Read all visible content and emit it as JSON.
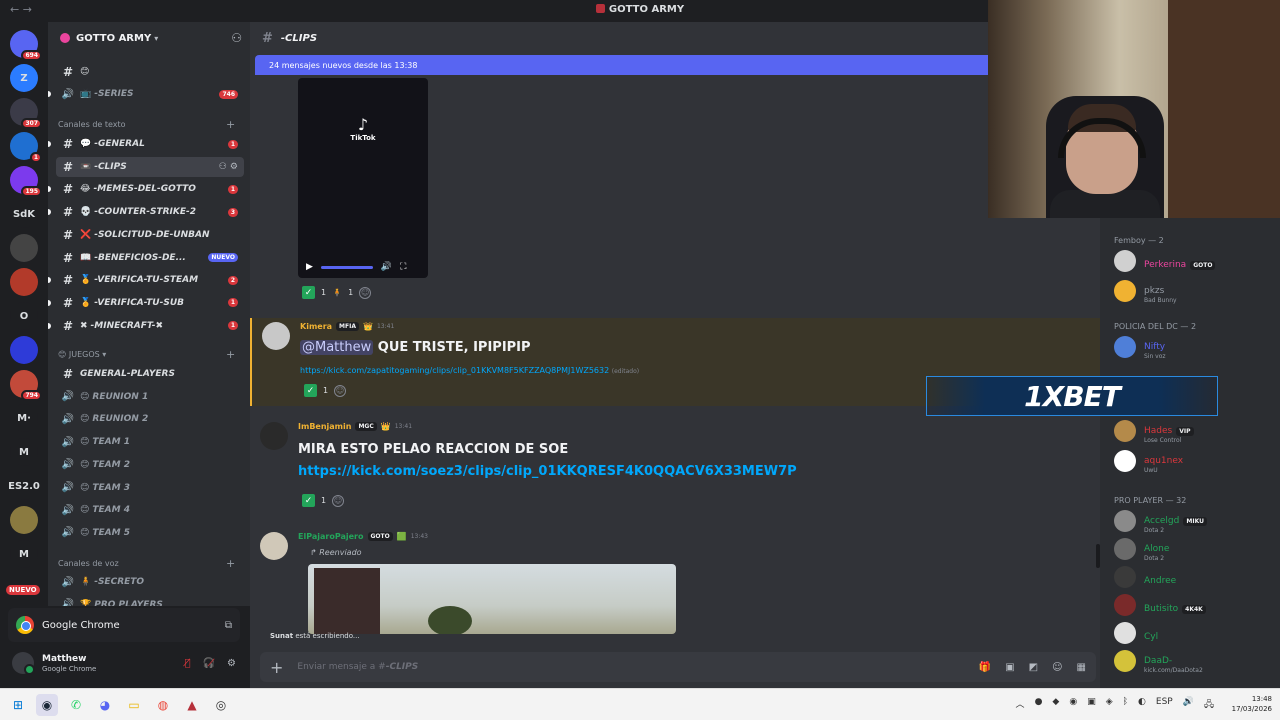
{
  "window": {
    "title": "GOTTO ARMY",
    "nav": "←  →"
  },
  "rail": {
    "servers": [
      {
        "icon": "discord-logo-icon",
        "label": "",
        "badge": "694",
        "color": "#5865f2"
      },
      {
        "icon": "server-z-icon",
        "label": "Z",
        "badge": "",
        "color": "#2b7cff"
      },
      {
        "icon": "server-icon",
        "label": "",
        "badge": "307",
        "color": "#3b3b48"
      },
      {
        "icon": "server-icon",
        "label": "",
        "badge": "1",
        "color": "#1f6fd1"
      },
      {
        "icon": "server-icon",
        "label": "",
        "badge": "195",
        "color": "#7c3aed"
      },
      {
        "icon": "server-sdk-icon",
        "label": "SdK",
        "badge": "",
        "color": "#1e1f22"
      },
      {
        "icon": "server-icon",
        "label": "",
        "badge": "",
        "color": "#444"
      },
      {
        "icon": "server-icon",
        "label": "",
        "badge": "",
        "color": "#b23a2a"
      },
      {
        "icon": "server-icon",
        "label": "O",
        "badge": "",
        "color": "#1e1f22"
      },
      {
        "icon": "server-icon",
        "label": "",
        "badge": "",
        "color": "#2e3bd8"
      },
      {
        "icon": "server-icon",
        "label": "",
        "badge": "794",
        "color": "#c24a3a"
      },
      {
        "icon": "server-m-icon",
        "label": "M·",
        "badge": "",
        "color": "#1e1f22"
      },
      {
        "icon": "server-m-icon",
        "label": "M",
        "badge": "",
        "color": "#1e1f22"
      },
      {
        "icon": "server-es-icon",
        "label": "ES2.0",
        "badge": "",
        "color": "#1e1f22"
      },
      {
        "icon": "server-icon",
        "label": "",
        "badge": "",
        "color": "#8a7a40"
      },
      {
        "icon": "server-m-icon",
        "label": "M",
        "badge": "",
        "color": "#1e1f22"
      }
    ],
    "new_label": "NUEVO"
  },
  "sidebar": {
    "server_name": "GOTTO ARMY",
    "top_channels": [
      {
        "name": "",
        "emoji": "😊",
        "type": "text",
        "badge": ""
      },
      {
        "name": "-SERIES",
        "emoji": "📺",
        "type": "voice",
        "badge": "746"
      }
    ],
    "text_category": "Canales de texto",
    "text_channels": [
      {
        "name": "-GENERAL",
        "emoji": "💬",
        "badge": "1",
        "active": false
      },
      {
        "name": "-CLIPS",
        "emoji": "📼",
        "badge": "",
        "active": true
      },
      {
        "name": "-MEMES-DEL-GOTTO",
        "emoji": "😂",
        "badge": "1",
        "active": false
      },
      {
        "name": "-COUNTER-STRIKE-2",
        "emoji": "💀",
        "badge": "3",
        "active": false
      },
      {
        "name": "-SOLICITUD-DE-UNBAN",
        "emoji": "❌",
        "badge": "",
        "active": false
      },
      {
        "name": "-BENEFICIOS-DE...",
        "emoji": "📖",
        "badge": "NUEVO",
        "active": false
      },
      {
        "name": "-VERIFICA-TU-STEAM",
        "emoji": "🏅",
        "badge": "2",
        "active": false
      },
      {
        "name": "-VERIFICA-TU-SUB",
        "emoji": "🏅",
        "badge": "1",
        "active": false
      },
      {
        "name": "-MINECRAFT-✖",
        "emoji": "✖",
        "badge": "1",
        "active": false
      }
    ],
    "games_category": "JUEGOS",
    "games_channels": [
      {
        "name": "GENERAL-PLAYERS",
        "emoji": "",
        "type": "text"
      },
      {
        "name": "REUNION 1",
        "emoji": "😊",
        "type": "voice"
      },
      {
        "name": "REUNION 2",
        "emoji": "😊",
        "type": "voice"
      },
      {
        "name": "TEAM 1",
        "emoji": "😊",
        "type": "voice"
      },
      {
        "name": "TEAM 2",
        "emoji": "😊",
        "type": "voice"
      },
      {
        "name": "TEAM 3",
        "emoji": "😊",
        "type": "voice"
      },
      {
        "name": "TEAM 4",
        "emoji": "😊",
        "type": "voice"
      },
      {
        "name": "TEAM 5",
        "emoji": "😊",
        "type": "voice"
      }
    ],
    "voice_category": "Canales de voz",
    "voice_channels": [
      {
        "name": "-SECRETO",
        "emoji": "🧍",
        "type": "voice"
      },
      {
        "name": "PRO PLAYERS",
        "emoji": "🏆",
        "type": "voice"
      }
    ]
  },
  "share": {
    "app": "Google Chrome"
  },
  "user": {
    "name": "Matthew",
    "status": "Google Chrome"
  },
  "channel": {
    "name": "-CLIPS",
    "new_messages": "24 mensajes nuevos desde las 13:38"
  },
  "video": {
    "logo_text": "TikTok",
    "reactions": [
      {
        "emoji": "✅",
        "count": "1"
      },
      {
        "emoji": "🧍",
        "count": "1"
      }
    ]
  },
  "messages": [
    {
      "author": "Kimera",
      "author_color": "#f0b232",
      "tag": "MFIA",
      "time": "13:41",
      "mention": "@Matthew",
      "text": "QUE TRISTE, IPIPIPIP",
      "link": "https://kick.com/zapatitogaming/clips/clip_01KKVM8F5KFZZAQ8PMJ1WZ5632",
      "edited": "(editado)",
      "reaction_count": "1"
    },
    {
      "author": "ImBenjamin",
      "author_color": "#f0b232",
      "tag": "MGC",
      "time": "13:41",
      "text": "MIRA ESTO PELAO REACCION DE SOE",
      "link": "https://kick.com/soez3/clips/clip_01KKQRESF4K0QQACV6X33MEW7P",
      "reaction_count": "1"
    },
    {
      "author": "ElPajaroPajero",
      "author_color": "#23a55a",
      "tag": "GOTO",
      "time": "13:43",
      "forwarded": "↱ Reenviado"
    }
  ],
  "typing": {
    "user": "Sunat",
    "text": "está escribiendo..."
  },
  "composer": {
    "placeholder_prefix": "Enviar mensaje a #",
    "placeholder_channel": "-CLIPS"
  },
  "members": {
    "groups": [
      {
        "title": "Femboy — 2",
        "members": [
          {
            "name": "Perkerina",
            "tag": "GOTO",
            "status": "",
            "color": "#eb459e",
            "avatar": "#d0d0d0"
          },
          {
            "name": "pkzs",
            "tag": "",
            "status": "Bad Bunny",
            "color": "#949ba4",
            "avatar": "#f0b232"
          }
        ]
      },
      {
        "title": "POLICIA DEL DC — 2",
        "members": [
          {
            "name": "Nifty",
            "tag": "",
            "status": "Sin voz",
            "color": "#5865f2",
            "avatar": "#4f7fd8"
          }
        ]
      },
      {
        "title": "",
        "members": [
          {
            "name": "Hades",
            "tag": "VIP",
            "status": "Lose Control",
            "color": "#da373c",
            "avatar": "#b48a4a"
          },
          {
            "name": "aqu1nex",
            "tag": "",
            "status": "UwU",
            "color": "#da373c",
            "avatar": "#ffffff"
          }
        ]
      },
      {
        "title": "PRO PLAYER — 32",
        "members": [
          {
            "name": "Accelgd",
            "tag": "MIKU",
            "status": "Dota 2",
            "color": "#23a55a",
            "avatar": "#8a8a8a"
          },
          {
            "name": "Alone",
            "tag": "",
            "status": "Dota 2",
            "color": "#23a55a",
            "avatar": "#6a6a6a"
          },
          {
            "name": "Andree",
            "tag": "",
            "status": "",
            "color": "#23a55a",
            "avatar": "#3a3a3a"
          },
          {
            "name": "Butisito",
            "tag": "4K4K",
            "status": "",
            "color": "#23a55a",
            "avatar": "#7a2a2a"
          },
          {
            "name": "Cyl",
            "tag": "",
            "status": "",
            "color": "#23a55a",
            "avatar": "#e0e0e0"
          },
          {
            "name": "DaaD-",
            "tag": "",
            "status": "kick.com/DaaDota2",
            "color": "#23a55a",
            "avatar": "#d4c23a"
          }
        ]
      }
    ]
  },
  "overlay": {
    "brand": "1XBET"
  },
  "taskbar": {
    "lang": "ESP",
    "time": "13:48",
    "date": "17/03/2026"
  }
}
